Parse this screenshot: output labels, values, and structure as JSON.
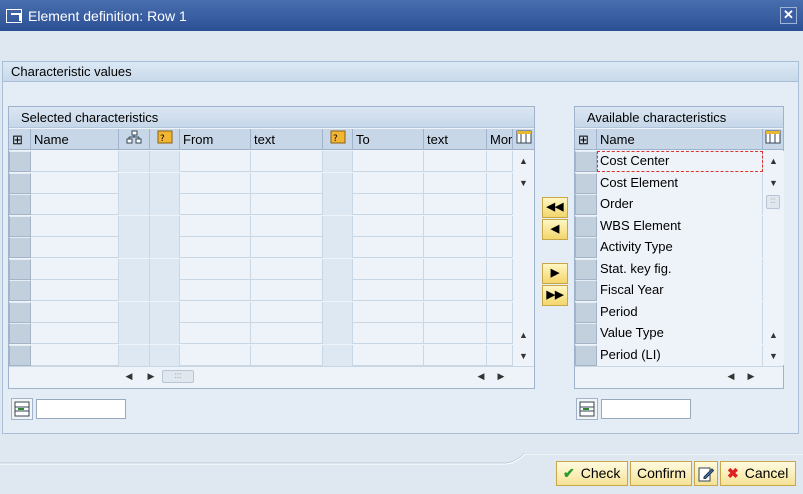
{
  "window": {
    "title": "Element definition: Row 1"
  },
  "group": {
    "title": "Characteristic values"
  },
  "selected": {
    "title": "Selected characteristics",
    "columns": [
      "Name",
      "From",
      "text",
      "To",
      "text",
      "Mor"
    ],
    "row_count": 10
  },
  "available": {
    "title": "Available characteristics",
    "column": "Name",
    "items": [
      "Cost Center",
      "Cost Element",
      "Order",
      "WBS Element",
      "Activity Type",
      "Stat. key fig.",
      "Fiscal Year",
      "Period",
      "Value Type",
      "Period (LI)"
    ]
  },
  "footer": {
    "check_label": "Check",
    "confirm_label": "Confirm",
    "cancel_label": "Cancel"
  },
  "colors": {
    "titlebar": "#2b4f94",
    "button_yellow": "#f3d66b"
  }
}
